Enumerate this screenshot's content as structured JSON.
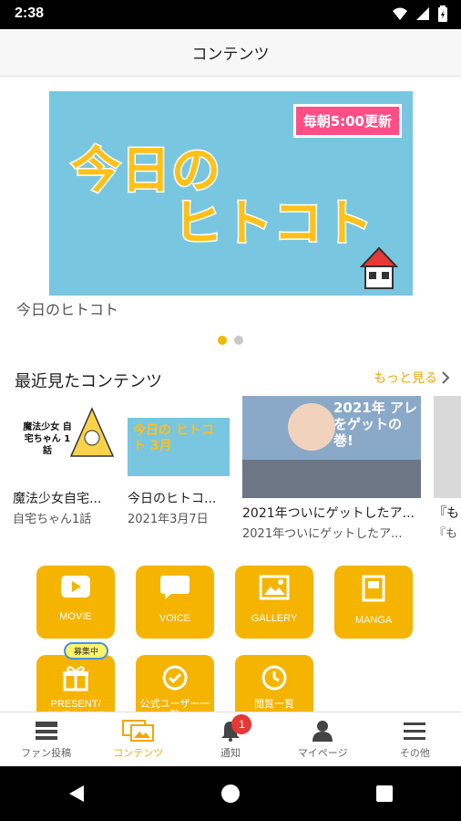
{
  "status_bar": {
    "time": "2:38"
  },
  "header": {
    "title": "コンテンツ"
  },
  "banner": {
    "tag": "毎朝5:00更新",
    "line1": "今日の",
    "line2": "ヒトコト",
    "caption": "今日のヒトコト",
    "page_count": 2,
    "active_page": 1
  },
  "recent": {
    "section_title": "最近見たコンテンツ",
    "see_more": "もっと見る",
    "items": [
      {
        "title": "魔法少女自宅...",
        "subtitle": "自宅ちゃん1話",
        "thumb_text": "魔法少女 自宅ちゃん 1話"
      },
      {
        "title": "今日のヒトコ...",
        "subtitle": "2021年3月7日",
        "thumb_text": "今日の ヒトコト 3月"
      },
      {
        "title": "2021年ついにゲットしたア...",
        "subtitle": "2021年ついにゲットしたア...",
        "thumb_text": "2021年 アレをゲットの巻!"
      },
      {
        "title": "『も",
        "subtitle": "『も"
      }
    ]
  },
  "menu": {
    "tiles": [
      {
        "label": "MOVIE"
      },
      {
        "label": "VOICE"
      },
      {
        "label": "GALLERY"
      },
      {
        "label": "MANGA"
      },
      {
        "label": "PRESENT/ GIVEAWAYS",
        "badge": "募集中"
      },
      {
        "label": "公式ユーザー一覧"
      },
      {
        "label": "閲覧一覧"
      }
    ]
  },
  "bottom_nav": {
    "items": [
      {
        "label": "ファン投稿"
      },
      {
        "label": "コンテンツ"
      },
      {
        "label": "通知",
        "badge": "1"
      },
      {
        "label": "マイページ"
      },
      {
        "label": "その他"
      }
    ]
  },
  "colors": {
    "accent": "#f5b400",
    "banner_bg": "#79c6e0",
    "badge_red": "#e53935"
  }
}
